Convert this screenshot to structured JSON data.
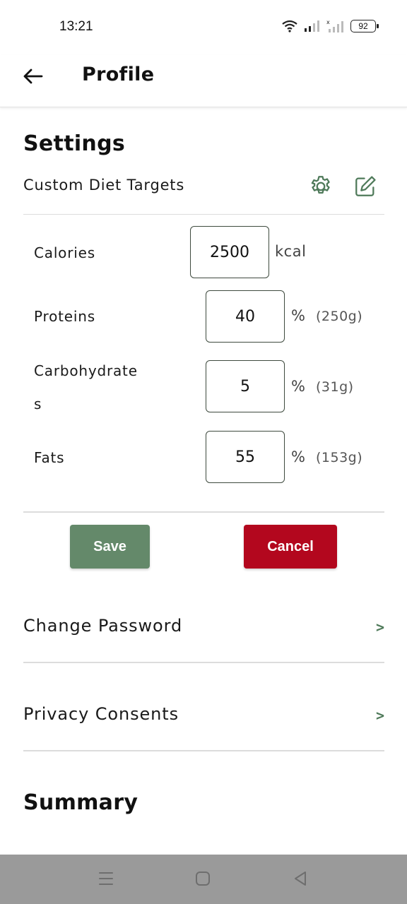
{
  "status_bar": {
    "time": "13:21",
    "battery": "92"
  },
  "header": {
    "title": "Profile"
  },
  "settings": {
    "title": "Settings",
    "diet": {
      "label": "Custom Diet Targets",
      "calories": {
        "label": "Calories",
        "value": "2500",
        "unit": "kcal"
      },
      "proteins": {
        "label": "Proteins",
        "value": "40",
        "unit": "%",
        "grams": "(250g)"
      },
      "carbohydrates": {
        "label_line1": "Carbohydrate",
        "label_line2": "s",
        "value": "5",
        "unit": "%",
        "grams": "(31g)"
      },
      "fats": {
        "label": "Fats",
        "value": "55",
        "unit": "%",
        "grams": "(153g)"
      }
    },
    "buttons": {
      "save": "Save",
      "cancel": "Cancel"
    },
    "nav": {
      "change_password": {
        "label": "Change Password",
        "chevron": ">"
      },
      "privacy_consents": {
        "label": "Privacy Consents",
        "chevron": ">"
      }
    }
  },
  "summary": {
    "title": "Summary"
  },
  "colors": {
    "accent_green": "#64896a",
    "danger_red": "#b3071e",
    "nav_bar": "#9a9a9a"
  },
  "icons": [
    "wifi-icon",
    "signal-icon",
    "battery-icon",
    "back-arrow-icon",
    "gear-icon",
    "edit-icon",
    "menu-icon",
    "home-icon",
    "back-triangle-icon"
  ]
}
